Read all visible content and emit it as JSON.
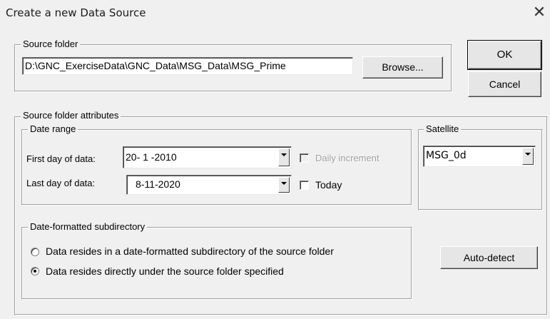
{
  "window": {
    "title": "Create a new Data Source",
    "close_glyph": "✕"
  },
  "source_folder": {
    "legend": "Source folder",
    "path_value": "D:\\GNC_ExerciseData\\GNC_Data\\MSG_Data\\MSG_Prime",
    "browse_label": "Browse..."
  },
  "buttons": {
    "ok_label": "OK",
    "cancel_label": "Cancel",
    "auto_detect_label": "Auto-detect"
  },
  "attributes": {
    "legend": "Source folder attributes",
    "date_range": {
      "legend": "Date range",
      "first_day_label": "First day of data:",
      "first_day_value": "20- 1 -2010",
      "last_day_label": "Last day of data:",
      "last_day_value": "8-11-2020",
      "daily_increment_label": "Daily increment",
      "daily_increment_checked": false,
      "daily_increment_enabled": false,
      "today_label": "Today",
      "today_checked": false
    },
    "satellite": {
      "legend": "Satellite",
      "selected": "MSG_0d"
    },
    "subdirectory": {
      "legend": "Date-formatted subdirectory",
      "options": [
        {
          "label": "Data resides in a date-formatted subdirectory of the source folder",
          "selected": false
        },
        {
          "label": "Data resides directly under the source folder specified",
          "selected": true
        }
      ]
    }
  },
  "icons": {
    "dropdown": "chevron-down-icon",
    "close": "close-icon"
  }
}
